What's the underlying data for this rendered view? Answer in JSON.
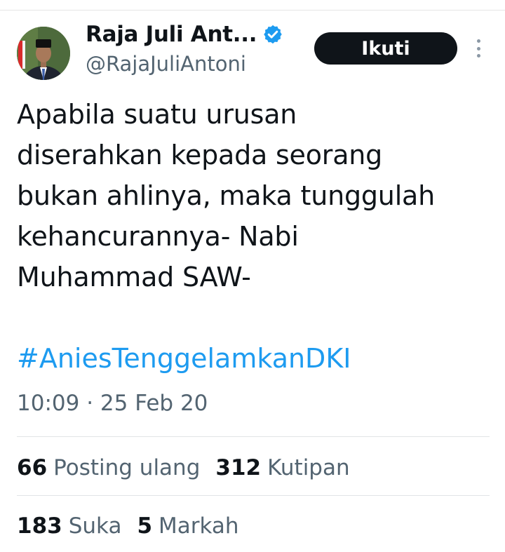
{
  "profile": {
    "display_name": "Raja Juli Ant...",
    "handle": "@RajaJuliAntoni",
    "verified": true,
    "verified_color": "#1d9bf0"
  },
  "actions": {
    "follow_label": "Ikuti"
  },
  "tweet": {
    "text": "Apabila suatu urusan\ndiserahkan kepada seorang\nbukan ahlinya, maka tunggulah\nkehancurannya- Nabi\nMuhammad SAW-",
    "hashtag": "#AniesTenggelamkanDKI",
    "hashtag_color": "#1d9bf0",
    "timestamp": "10:09 · 25 Feb 20"
  },
  "stats": {
    "reposts_value": "66",
    "reposts_label": "Posting ulang",
    "quotes_value": "312",
    "quotes_label": "Kutipan",
    "likes_value": "183",
    "likes_label": "Suka",
    "bookmarks_value": "5",
    "bookmarks_label": "Markah"
  }
}
